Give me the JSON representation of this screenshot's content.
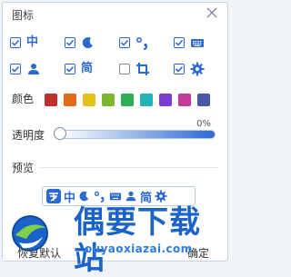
{
  "window": {
    "title": "图标"
  },
  "icons": {
    "row1": [
      {
        "name": "chinese",
        "text": "中",
        "checked": true
      },
      {
        "name": "moon-icon",
        "text": "",
        "checked": true
      },
      {
        "name": "punctuation-icon",
        "text": "",
        "checked": true
      },
      {
        "name": "keyboard-icon",
        "text": "",
        "checked": true
      }
    ],
    "row2": [
      {
        "name": "user-icon",
        "text": "",
        "checked": true
      },
      {
        "name": "simplified",
        "text": "简",
        "checked": true
      },
      {
        "name": "crop-icon",
        "text": "",
        "checked": false
      },
      {
        "name": "gear-icon",
        "text": "",
        "checked": true
      }
    ]
  },
  "color": {
    "label": "颜色",
    "swatches": [
      "#c0302b",
      "#e26b1b",
      "#e3c21a",
      "#7cb82e",
      "#2fae58",
      "#22b3b6",
      "#7a3fd1",
      "#c23b9a",
      "#4a57a8"
    ]
  },
  "opacity": {
    "label": "透明度",
    "value_text": "0%",
    "value": 0
  },
  "preview": {
    "label": "预览",
    "items": [
      "logo-icon",
      "中",
      "moon-icon",
      "punctuation-icon",
      "keyboard-icon",
      "user-icon",
      "简",
      "gear-icon"
    ]
  },
  "footer": {
    "reset_label": "恢复默认",
    "ok_label": "确定"
  },
  "watermark": {
    "text": "偶要下载站",
    "url": "ouyaoxiazai.com"
  },
  "accent": "#2d6ad0"
}
